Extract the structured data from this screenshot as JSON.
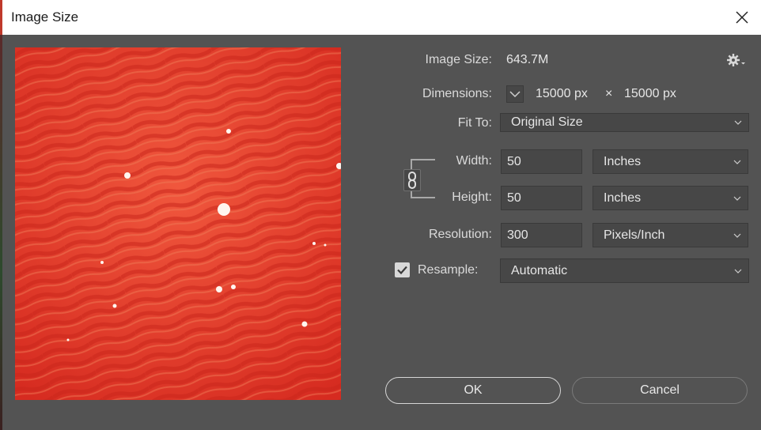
{
  "window": {
    "title": "Image Size"
  },
  "info": {
    "image_size_label": "Image Size:",
    "image_size_value": "643.7M",
    "dimensions_label": "Dimensions:",
    "dim_width": "15000 px",
    "dim_times": "×",
    "dim_height": "15000 px"
  },
  "fit_to": {
    "label": "Fit To:",
    "value": "Original Size"
  },
  "width": {
    "label": "Width:",
    "value": "50",
    "unit": "Inches"
  },
  "height": {
    "label": "Height:",
    "value": "50",
    "unit": "Inches"
  },
  "resolution": {
    "label": "Resolution:",
    "value": "300",
    "unit": "Pixels/Inch"
  },
  "resample": {
    "label": "Resample:",
    "checked": true,
    "value": "Automatic"
  },
  "buttons": {
    "ok": "OK",
    "cancel": "Cancel"
  },
  "icons": {
    "close": "close-icon",
    "gear": "gear-icon",
    "chevron": "chevron-down-icon",
    "link": "link-icon",
    "check": "check-icon"
  },
  "colors": {
    "dialog_bg": "#535353",
    "field_bg": "#474747",
    "text": "#e6e6e6",
    "preview_red": "#e8402f"
  }
}
